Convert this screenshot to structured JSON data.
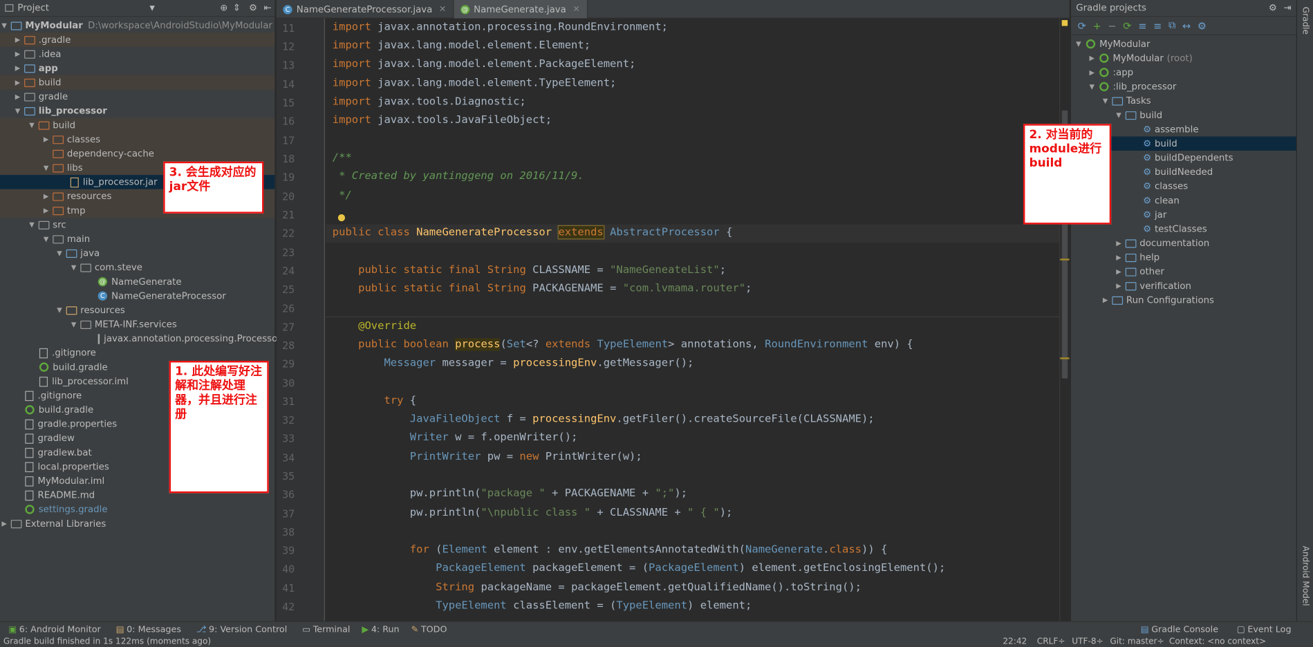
{
  "project_panel": {
    "title": "Project",
    "items": [
      {
        "label": "MyModular",
        "path": "D:\\workspace\\AndroidStudio\\MyModular"
      },
      {
        "label": ".gradle"
      },
      {
        "label": ".idea"
      },
      {
        "label": "app"
      },
      {
        "label": "build"
      },
      {
        "label": "gradle"
      },
      {
        "label": "lib_processor"
      },
      {
        "label": "build"
      },
      {
        "label": "classes"
      },
      {
        "label": "dependency-cache"
      },
      {
        "label": "libs"
      },
      {
        "label": "lib_processor.jar"
      },
      {
        "label": "resources"
      },
      {
        "label": "tmp"
      },
      {
        "label": "src"
      },
      {
        "label": "main"
      },
      {
        "label": "java"
      },
      {
        "label": "com.steve"
      },
      {
        "label": "NameGenerate"
      },
      {
        "label": "NameGenerateProcessor"
      },
      {
        "label": "resources"
      },
      {
        "label": "META-INF.services"
      },
      {
        "label": "javax.annotation.processing.Processor"
      },
      {
        "label": ".gitignore"
      },
      {
        "label": "build.gradle"
      },
      {
        "label": "lib_processor.iml"
      },
      {
        "label": ".gitignore"
      },
      {
        "label": "build.gradle"
      },
      {
        "label": "gradle.properties"
      },
      {
        "label": "gradlew"
      },
      {
        "label": "gradlew.bat"
      },
      {
        "label": "local.properties"
      },
      {
        "label": "MyModular.iml"
      },
      {
        "label": "README.md"
      },
      {
        "label": "settings.gradle"
      },
      {
        "label": "External Libraries"
      }
    ]
  },
  "tabs": [
    {
      "label": "NameGenerateProcessor.java"
    },
    {
      "label": "NameGenerate.java"
    }
  ],
  "editor": {
    "line_numbers": [
      "11",
      "12",
      "13",
      "14",
      "15",
      "16",
      "17",
      "18",
      "19",
      "20",
      "21",
      "22",
      "23",
      "24",
      "25",
      "26",
      "27",
      "28",
      "29",
      "30",
      "31",
      "32",
      "33",
      "34",
      "35",
      "36",
      "37",
      "38",
      "39",
      "40",
      "41",
      "42"
    ]
  },
  "gradle_panel": {
    "title": "Gradle projects",
    "items": [
      {
        "label": "MyModular"
      },
      {
        "label": "MyModular",
        "suffix": "(root)"
      },
      {
        "label": ":app"
      },
      {
        "label": ":lib_processor"
      },
      {
        "label": "Tasks"
      },
      {
        "label": "build"
      },
      {
        "label": "assemble"
      },
      {
        "label": "build"
      },
      {
        "label": "buildDependents"
      },
      {
        "label": "buildNeeded"
      },
      {
        "label": "classes"
      },
      {
        "label": "clean"
      },
      {
        "label": "jar"
      },
      {
        "label": "testClasses"
      },
      {
        "label": "documentation"
      },
      {
        "label": "help"
      },
      {
        "label": "other"
      },
      {
        "label": "verification"
      },
      {
        "label": "Run Configurations"
      }
    ],
    "side_label": "Gradle",
    "side_label2": "Android Model"
  },
  "annotations": {
    "note1": "1. 此处编写好注解和注解处理器，并且进行注册",
    "note2": "2. 对当前的module进行build",
    "note3": "3. 会生成对应的jar文件"
  },
  "toolwindows": {
    "android_monitor": "6: Android Monitor",
    "messages": "0: Messages",
    "version_control": "9: Version Control",
    "terminal": "Terminal",
    "run": "4: Run",
    "todo": "TODO",
    "gradle_console": "Gradle Console",
    "event_log": "Event Log"
  },
  "statusbar": {
    "message": "Gradle build finished in 1s 122ms (moments ago)",
    "position": "22:42",
    "line_sep": "CRLF÷",
    "encoding": "UTF-8÷",
    "git": "Git: master÷",
    "context": "Context: <no context>"
  }
}
